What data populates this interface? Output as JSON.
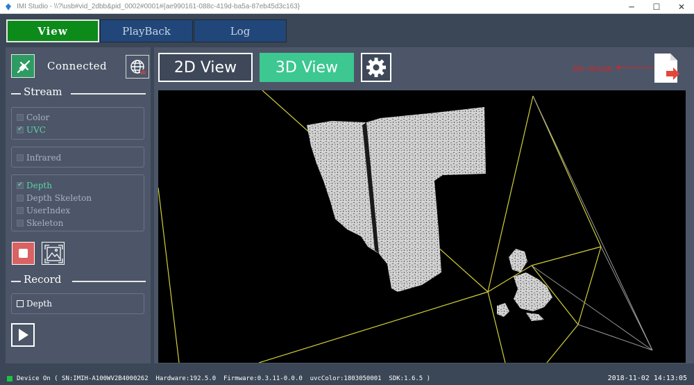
{
  "window": {
    "title": "IMI Studio - \\\\?\\usb#vid_2dbb&pid_0002#0001#{ae990161-088c-419d-ba5a-87eb45d3c163}",
    "minimize": "─",
    "maximize": "☐",
    "close": "✕"
  },
  "tabs": [
    {
      "label": "View",
      "active": true
    },
    {
      "label": "PlayBack",
      "active": false
    },
    {
      "label": "Log",
      "active": false
    }
  ],
  "connection": {
    "status_label": "Connected"
  },
  "stream": {
    "heading": "Stream",
    "group1": [
      {
        "label": "Color",
        "checked": false,
        "mark": ""
      },
      {
        "label": "UVC",
        "checked": true,
        "mark": "✔"
      }
    ],
    "group2": [
      {
        "label": "Infrared",
        "checked": false,
        "mark": ""
      }
    ],
    "group3": [
      {
        "label": "Depth",
        "checked": true,
        "mark": "✔"
      },
      {
        "label": "Depth Skeleton",
        "checked": false,
        "mark": ""
      },
      {
        "label": "UserIndex",
        "checked": false,
        "mark": ""
      },
      {
        "label": "Skeleton",
        "checked": false,
        "mark": ""
      }
    ]
  },
  "record": {
    "heading": "Record",
    "depth_label": "Depth"
  },
  "view": {
    "btn_2d": "2D View",
    "btn_3d": "3D View",
    "annotation": "保存一帧点云图"
  },
  "colors": {
    "active_tab": "#0c8a1a",
    "accent": "#3cc890",
    "frustum": "#d4d03a",
    "pointcloud": "#d8d8d8"
  },
  "status": {
    "text": "Device On ( SN:IMIH-A100WV2B4000262  Hardware:192.5.0  Firmware:0.3.11-0.0.0  uvcColor:1803050001  SDK:1.6.5 )",
    "time": "2018-11-02 14:13:05"
  }
}
